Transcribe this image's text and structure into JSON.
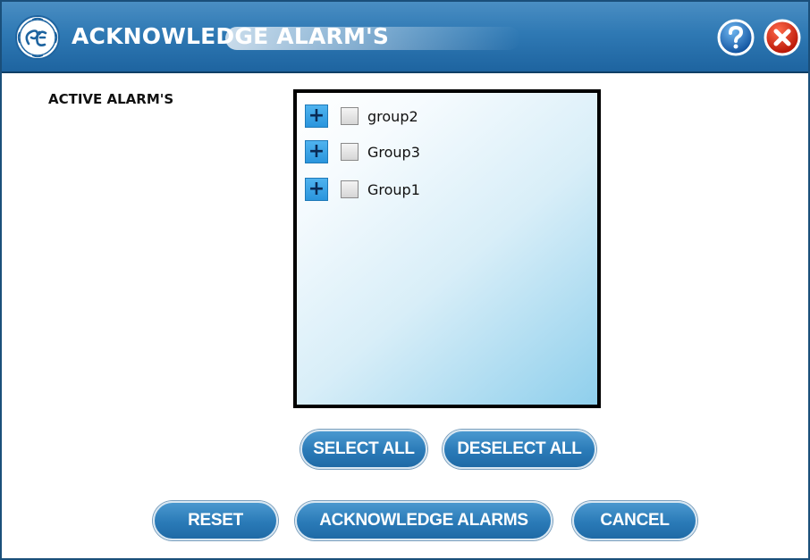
{
  "window": {
    "title": "ACKNOWLEDGE ALARM'S",
    "logo_icon": "ge-logo-icon",
    "help_icon": "help-question-icon",
    "close_icon": "close-x-icon"
  },
  "main": {
    "active_alarms_label": "ACTIVE ALARM'S",
    "tree": {
      "items": [
        {
          "expander": "+",
          "label": "group2",
          "checked": false
        },
        {
          "expander": "+",
          "label": "Group3",
          "checked": false
        },
        {
          "expander": "+",
          "label": "Group1",
          "checked": false
        }
      ]
    }
  },
  "buttons": {
    "select_all": "SELECT ALL",
    "deselect_all": "DESELECT ALL",
    "reset": "RESET",
    "acknowledge": "ACKNOWLEDGE ALARMS",
    "cancel": "CANCEL"
  },
  "colors": {
    "titlebar": "#2f79b4",
    "button": "#2a7ab7",
    "expander": "#2a95dd",
    "close_red": "#d81e05"
  }
}
